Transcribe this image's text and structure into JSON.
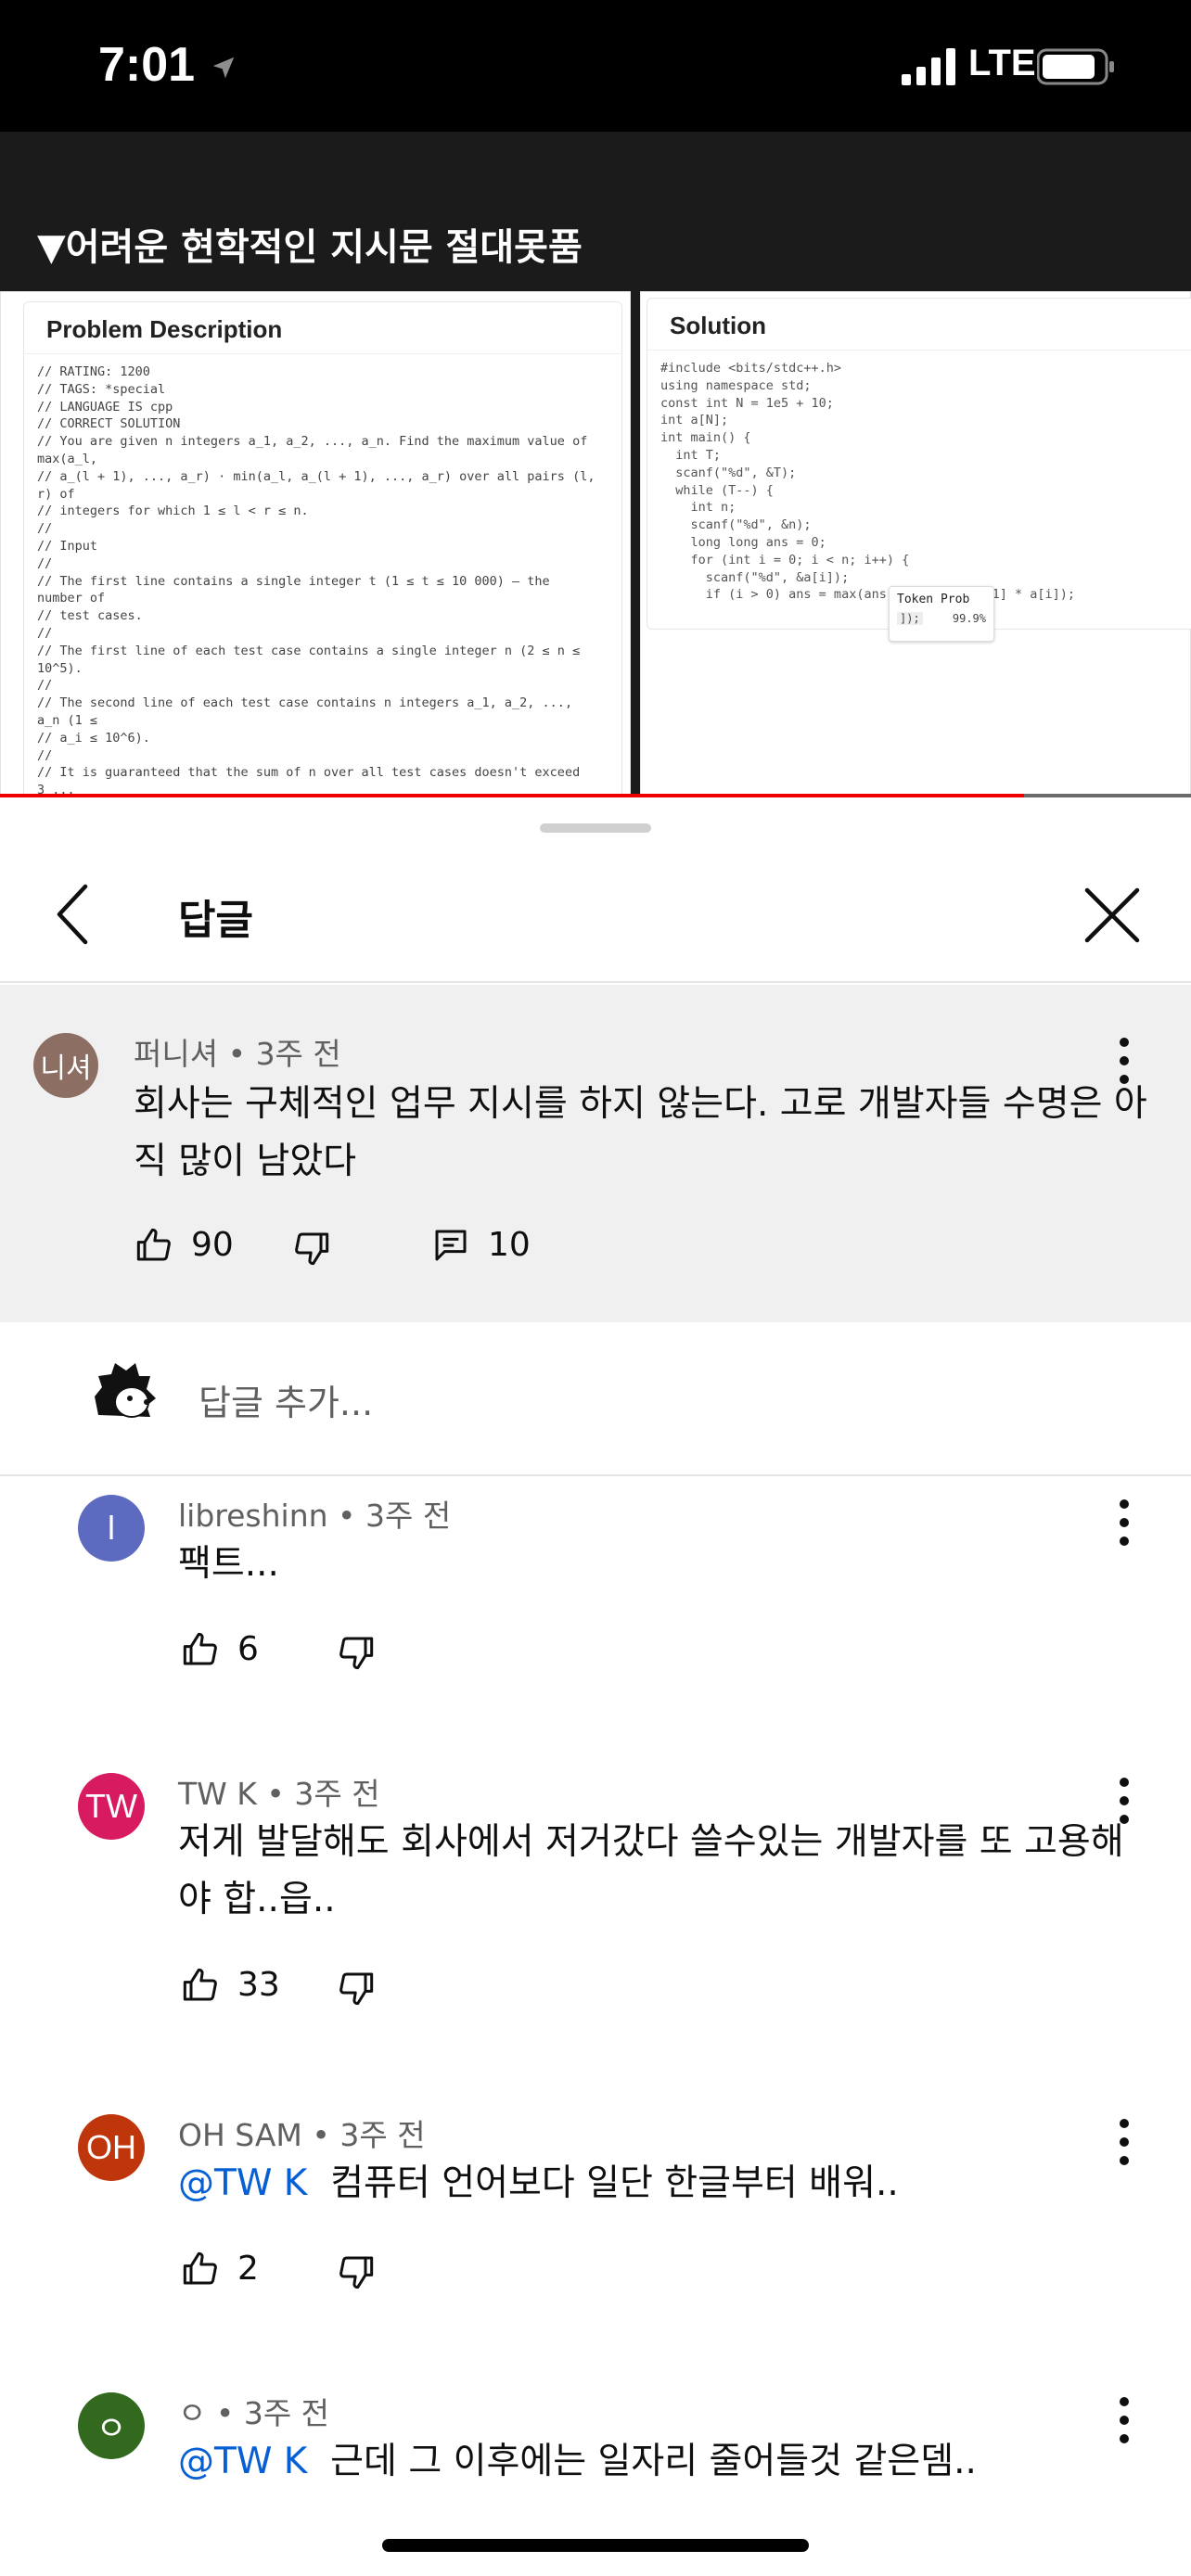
{
  "status": {
    "time": "7:01",
    "network": "LTE"
  },
  "video": {
    "caption": "▼어려운 현학적인 지시문 절대못품",
    "left_panel": {
      "title": "Problem Description",
      "lines": [
        "// RATING: 1200",
        "// TAGS: *special",
        "// LANGUAGE IS cpp",
        "// CORRECT SOLUTION",
        "// You are given n integers a_1, a_2, ..., a_n. Find the maximum value of",
        "max(a_l,",
        "// a_(l + 1), ..., a_r) · min(a_l, a_(l + 1), ..., a_r) over all pairs (l,",
        "r) of",
        "// integers for which 1 ≤ l < r ≤ n.",
        "//",
        "// Input",
        "//",
        "// The first line contains a single integer t (1 ≤ t ≤ 10 000) — the",
        "number of",
        "// test cases.",
        "//",
        "// The first line of each test case contains a single integer n (2 ≤ n ≤",
        "10^5).",
        "//",
        "// The second line of each test case contains n integers a_1, a_2, ...,",
        "a_n (1 ≤",
        "// a_i ≤ 10^6).",
        "//",
        "// It is guaranteed that the sum of n over all test cases doesn't exceed",
        "3 ..."
      ]
    },
    "right_panel": {
      "title": "Solution",
      "lines": [
        "#include <bits/stdc++.h>",
        "using namespace std;",
        "const int N = 1e5 + 10;",
        "int a[N];",
        "int main() {",
        "  int T;",
        "  scanf(\"%d\", &T);",
        "  while (T--) {",
        "    int n;",
        "    scanf(\"%d\", &n);",
        "    long long ans = 0;",
        "    for (int i = 0; i < n; i++) {",
        "      scanf(\"%d\", &a[i]);",
        "      if (i > 0) ans = max(ans, 1ll * a[i - 1] * a[i]);"
      ]
    },
    "token_prob": {
      "header": "Token Prob",
      "token": "]);",
      "value": "99.9%"
    }
  },
  "sheet": {
    "title": "답글",
    "parent": {
      "avatar_text": "니셔",
      "avatar_color": "#8d6e63",
      "author": "퍼니셔",
      "time": "3주 전",
      "text": "회사는 구체적인 업무 지시를 하지 않는다. 고로 개발자들 수명은 아직 많이 남았다",
      "likes": "90",
      "replies": "10"
    },
    "add_reply_placeholder": "답글 추가...",
    "replies": [
      {
        "avatar_text": "l",
        "avatar_color": "#5c6bc0",
        "author": "libreshinn",
        "time": "3주 전",
        "mention": "",
        "text": "팩트...",
        "likes": "6"
      },
      {
        "avatar_text": "TW",
        "avatar_color": "#d81b60",
        "author": "TW K",
        "time": "3주 전",
        "mention": "",
        "text": "저게 발달해도 회사에서 저거갔다 쓸수있는 개발자를 또 고용해야 합..읍..",
        "likes": "33"
      },
      {
        "avatar_text": "OH",
        "avatar_color": "#bf360c",
        "author": "OH SAM",
        "time": "3주 전",
        "mention": "@TW K",
        "text": "컴퓨터 언어보다 일단 한글부터 배워..",
        "likes": "2"
      },
      {
        "avatar_text": "ㅇ",
        "avatar_color": "#33691e",
        "author": "ㅇ",
        "time": "3주 전",
        "mention": "@TW K",
        "text": "근데 그 이후에는 일자리 줄어들것 같은뎀..",
        "likes": ""
      }
    ]
  }
}
